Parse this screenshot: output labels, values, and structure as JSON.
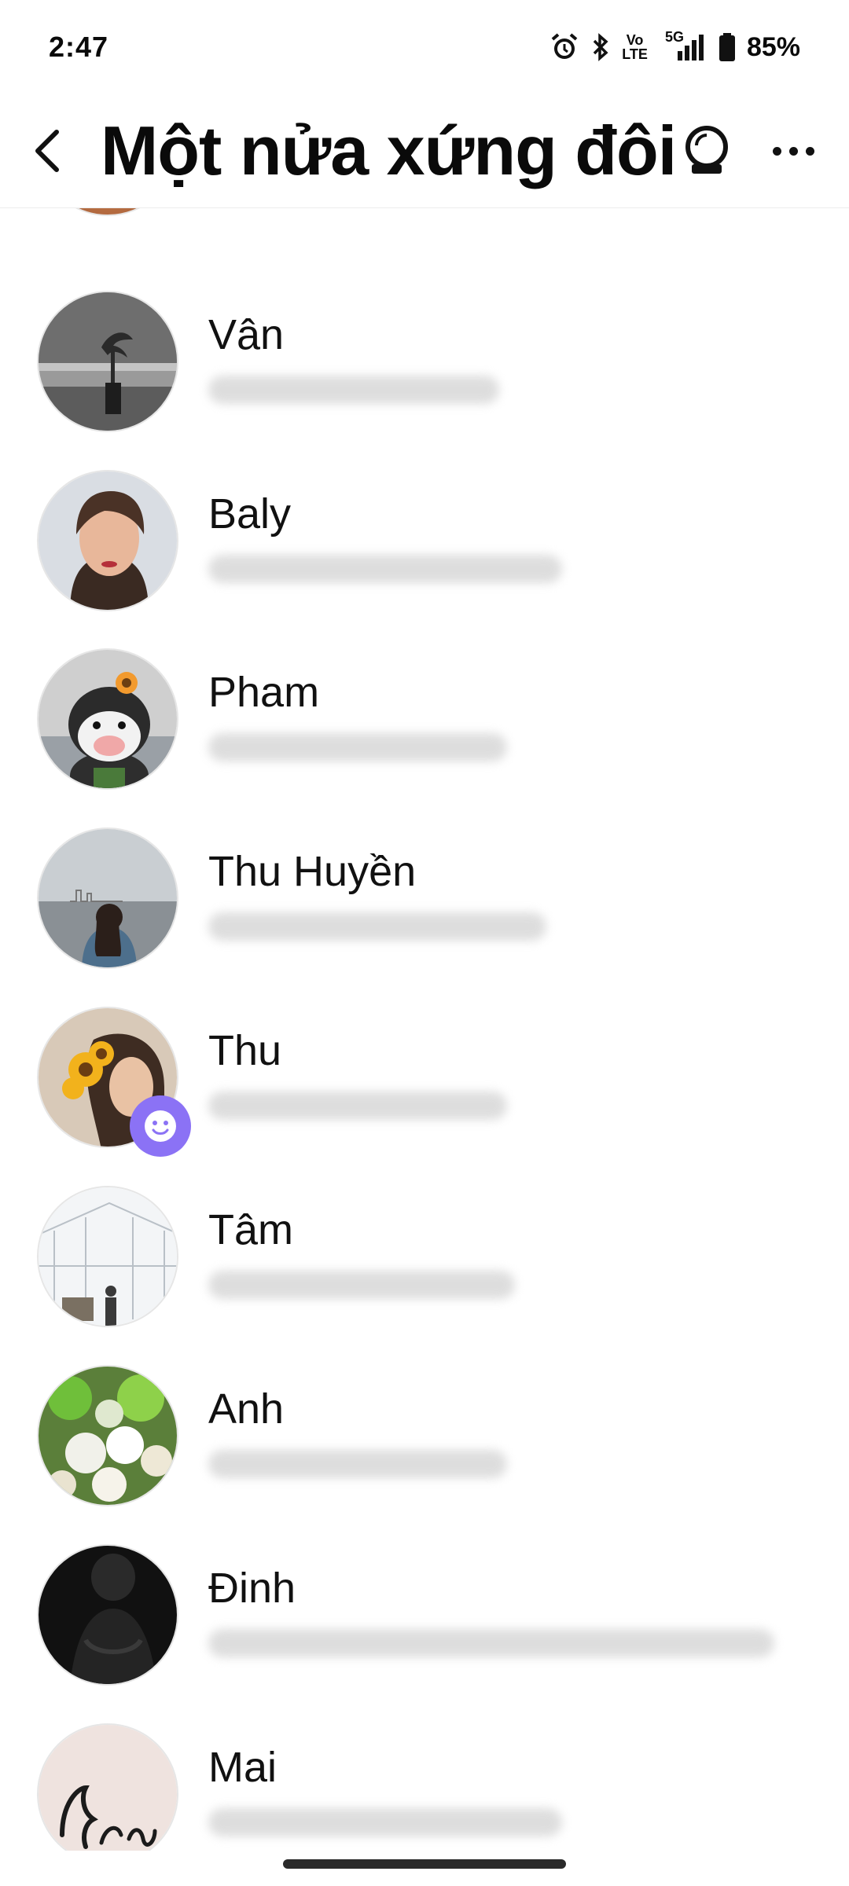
{
  "status_bar": {
    "time": "2:47",
    "network": "5G",
    "volte_top": "Vo",
    "volte_bottom": "LTE",
    "battery": "85%"
  },
  "header": {
    "title": "Một nửa xứng đôi"
  },
  "contacts": [
    {
      "name": "",
      "avatar": "orange-partial-avatar"
    },
    {
      "name": "Vân",
      "avatar": "bw-palm-photo"
    },
    {
      "name": "Baly",
      "avatar": "woman-portrait"
    },
    {
      "name": "Pham",
      "avatar": "cow-plush"
    },
    {
      "name": "Thu Huyền",
      "avatar": "lake-skyline"
    },
    {
      "name": "Thu",
      "avatar": "sunflower-portrait",
      "badge": "smiley-icon"
    },
    {
      "name": "Tâm",
      "avatar": "glass-roof"
    },
    {
      "name": "Anh",
      "avatar": "white-flowers"
    },
    {
      "name": "Đinh",
      "avatar": "dark-silhouette"
    },
    {
      "name": "Mai",
      "avatar": "handwriting"
    }
  ],
  "colors": {
    "accent": "#8b72f5",
    "background": "#ffffff",
    "text": "#0a0a0a"
  }
}
